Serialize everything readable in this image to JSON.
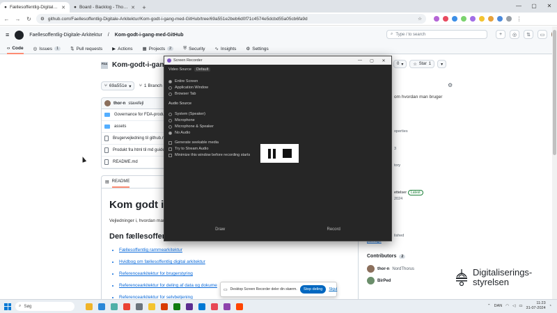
{
  "browser": {
    "tabs": [
      {
        "title": "Fællesoffentlig-Digitale-Arkitektur",
        "active": true
      },
      {
        "title": "Board - Backlog - Thor/Ringitte",
        "active": false
      }
    ],
    "new_tab": "+",
    "url": "github.com/Faellesoffentlig-Digitale-Arkitektur/Kom-godt-i-gang-med-GitHub/tree/69a551e2beb6d0f71c4574e5dcbd55a05cb6fa9d",
    "ext_colors": [
      "#b565d6",
      "#e84a5f",
      "#3c8ee6",
      "#7bd36e",
      "#a26ee6",
      "#f4c430",
      "#e6a13c",
      "#4a89dc",
      "#9aa0a6"
    ]
  },
  "github": {
    "org": "Faellesoffentlig-Digitale-Arkitektur",
    "repo": "Kom-godt-i-gang-med-GitHub",
    "search_placeholder": "Type / to search",
    "nav": [
      {
        "label": "Code",
        "count": "",
        "active": true
      },
      {
        "label": "Issues",
        "count": "1",
        "active": false
      },
      {
        "label": "Pull requests",
        "count": "",
        "active": false
      },
      {
        "label": "Actions",
        "count": "",
        "active": false
      },
      {
        "label": "Projects",
        "count": "2",
        "active": false
      },
      {
        "label": "Security",
        "count": "",
        "active": false
      },
      {
        "label": "Insights",
        "count": "",
        "active": false
      },
      {
        "label": "Settings",
        "count": "",
        "active": false
      }
    ],
    "repo_title": "Kom-godt-i-gang-m",
    "repo_avatar_text": "FDA",
    "branch": "69a551e",
    "branch_count": "1 Branch",
    "commit_author": "thor-n",
    "commit_msg": "stavefejl",
    "files": [
      {
        "name": "Governance for FDA-produkter",
        "type": "folder"
      },
      {
        "name": "assets",
        "type": "folder"
      },
      {
        "name": "Brugervejledning til github.md",
        "type": "file"
      },
      {
        "name": "Produkt fra html til md guide.md",
        "type": "file"
      },
      {
        "name": "README.md",
        "type": "file"
      }
    ],
    "readme_label": "README",
    "readme_h1": "Kom godt i g",
    "readme_p": "Vejledninger i, hvordan man",
    "readme_h2": "Den fællesoffentlig",
    "readme_links": [
      "Fællesoffentlig rammearkitektur",
      "Hvidbog om fællesoffentlig digital arkitektur",
      "Referencearkitektur for brugerstyring",
      "Referencearkitektur for deling af data og dokume",
      "Referencearkitektur for selvbetjening"
    ],
    "side_buttons": [
      {
        "label": "0",
        "icon": "▾"
      },
      {
        "label": "Star",
        "icon": "☆"
      },
      {
        "label": "1",
        "icon": "▾"
      }
    ],
    "about": "om hvordan man bruger",
    "side_fragments": {
      "properties": "operties",
      "repo_stat": "3",
      "history": "tory",
      "release": "ettelser",
      "latest": "Latest",
      "release_date": "2024",
      "package_note": "lished",
      "package_link": "package"
    },
    "contributors_title": "Contributors",
    "contributors_count": "2",
    "contributors": [
      {
        "login": "thor-n",
        "name": "NordThorus"
      },
      {
        "login": "BirPed",
        "name": ""
      }
    ]
  },
  "logo": {
    "line1": "Digitaliserings-",
    "line2": "styrelsen"
  },
  "recorder": {
    "title": "Screen Recorder",
    "video_source_label": "Video Source",
    "video_source_value": "Default",
    "video_options": [
      {
        "label": "Entire Screen",
        "on": true
      },
      {
        "label": "Application Window",
        "on": false
      },
      {
        "label": "Browser Tab",
        "on": false
      }
    ],
    "audio_source_label": "Audio Source",
    "audio_options": [
      {
        "label": "System (Speaker)",
        "on": false
      },
      {
        "label": "Microphone",
        "on": false
      },
      {
        "label": "Microphone & Speaker",
        "on": false
      },
      {
        "label": "No Audio",
        "on": true
      }
    ],
    "checks": [
      "Generate seekable media",
      "Try to Stream Audio",
      "Minimize this window before recording starts"
    ],
    "footer_left": "Draw",
    "footer_right": "Record"
  },
  "sharebar": {
    "text": "Desktop Screen Recorder deler din skærm.",
    "stop": "Stop deling",
    "hide": "Skjul"
  },
  "taskbar": {
    "search": "Søg",
    "lang": "DAN",
    "time": "11:23",
    "date": "31-07-2024",
    "app_colors": [
      "#f0b429",
      "#2b88d8",
      "#4fb0a7",
      "#ea4335",
      "#6c757d",
      "#f4c430",
      "#d83b01",
      "#107c10",
      "#5c2d91",
      "#0078d4",
      "#e74856",
      "#8e44ad",
      "#ff4500"
    ]
  }
}
